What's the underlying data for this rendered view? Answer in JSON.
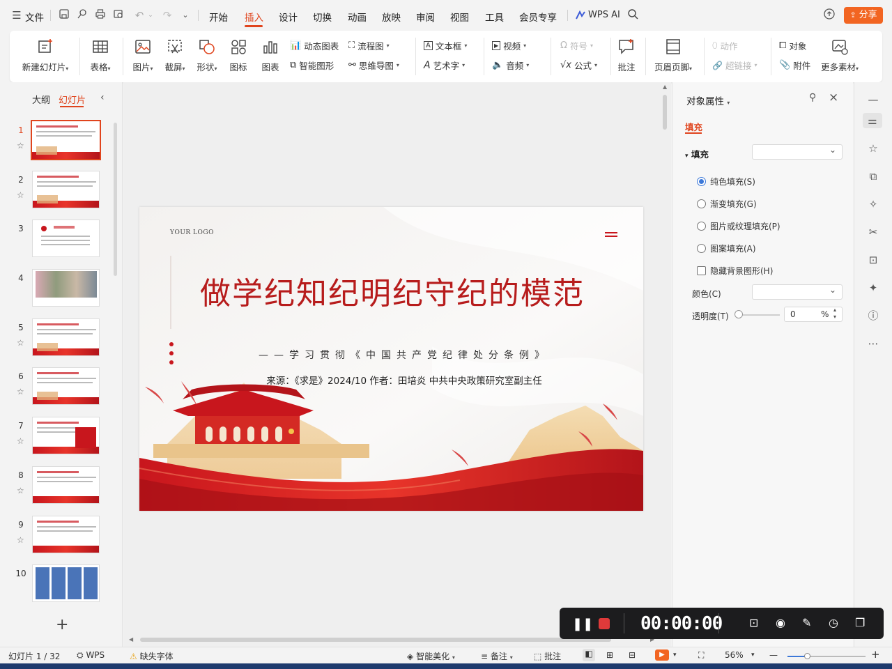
{
  "menubar": {
    "file_label": "文件",
    "tabs": [
      "开始",
      "插入",
      "设计",
      "切换",
      "动画",
      "放映",
      "审阅",
      "视图",
      "工具",
      "会员专享"
    ],
    "active_tab": "插入",
    "wps_ai_label": "WPS AI",
    "share_label": "分享"
  },
  "ribbon": {
    "new_slide": "新建幻灯片",
    "table": "表格",
    "picture": "图片",
    "screenshot": "截屏",
    "shape": "形状",
    "icon": "图标",
    "chart": "图表",
    "dynamic_chart": "动态图表",
    "smart_shape": "智能图形",
    "flowchart": "流程图",
    "mindmap": "思维导图",
    "textbox": "文本框",
    "wordart": "艺术字",
    "video": "视频",
    "audio": "音频",
    "symbol": "符号",
    "formula": "公式",
    "comment": "批注",
    "header_footer": "页眉页脚",
    "action": "动作",
    "hyperlink": "超链接",
    "object": "对象",
    "attachment": "附件",
    "more_material": "更多素材"
  },
  "leftpanel": {
    "tab_outline": "大纲",
    "tab_slides": "幻灯片",
    "thumbnails": [
      {
        "num": "1",
        "text": "做学纪知纪明纪守纪的模范"
      },
      {
        "num": "2",
        "text": "前言导语"
      },
      {
        "num": "3",
        "text": "人民日报"
      },
      {
        "num": "4",
        "text": ""
      },
      {
        "num": "5",
        "text": "目录"
      },
      {
        "num": "6",
        "text": "深化对党规的纪律解读"
      },
      {
        "num": "7",
        "text": ""
      },
      {
        "num": "8",
        "text": ""
      },
      {
        "num": "9",
        "text": ""
      },
      {
        "num": "10",
        "text": ""
      }
    ],
    "add_slide": "+"
  },
  "slide": {
    "logo": "YOUR LOGO",
    "title": "做学纪知纪明纪守纪的模范",
    "subtitle": "——学习贯彻《中国共产党纪律处分条例》",
    "source": "来源：《求是》2024/10 作者：田培炎 中共中央政策研究室副主任",
    "colors": {
      "primary_red": "#c8161d",
      "title_red": "#b71c1c"
    }
  },
  "rightpanel": {
    "title": "对象属性",
    "tab_fill": "填充",
    "section_fill": "填充",
    "options": [
      {
        "label": "纯色填充(S)",
        "checked": true
      },
      {
        "label": "渐变填充(G)",
        "checked": false
      },
      {
        "label": "图片或纹理填充(P)",
        "checked": false
      },
      {
        "label": "图案填充(A)",
        "checked": false
      }
    ],
    "hide_bg_label": "隐藏背景图形(H)",
    "color_label": "颜色(C)",
    "transparency_label": "透明度(T)",
    "transparency_value": "0",
    "transparency_unit": "%"
  },
  "statusbar": {
    "slide_info": "幻灯片 1 / 32",
    "wps_label": "WPS",
    "missing_font": "缺失字体",
    "smart_beautify": "智能美化",
    "notes": "备注",
    "comment": "批注",
    "zoom": "56%"
  },
  "recorder": {
    "timer": "00:00:00"
  }
}
